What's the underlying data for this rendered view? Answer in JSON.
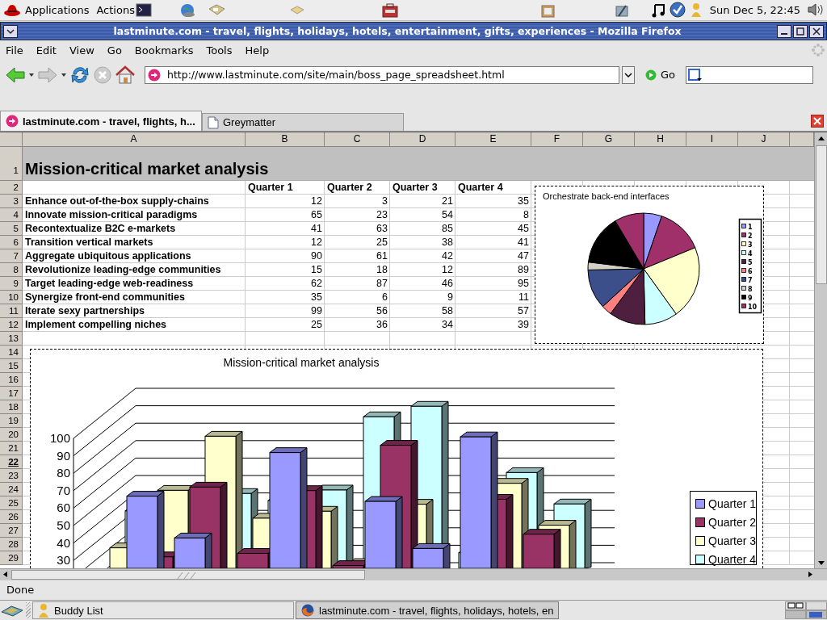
{
  "top_panel": {
    "menus": [
      "Applications",
      "Actions"
    ],
    "clock": "Sun Dec  5, 22:45"
  },
  "window": {
    "title": "lastminute.com - travel, flights, holidays, hotels, entertainment, gifts, experiences - Mozilla Firefox"
  },
  "menu_bar": [
    "File",
    "Edit",
    "View",
    "Go",
    "Bookmarks",
    "Tools",
    "Help"
  ],
  "nav": {
    "url": "http://www.lastminute.com/site/main/boss_page_spreadsheet.html",
    "go": "Go"
  },
  "tabs": [
    {
      "label": "lastminute.com - travel, flights, h...",
      "selected": true
    },
    {
      "label": "Greymatter",
      "selected": false
    }
  ],
  "sheet": {
    "columns": [
      "A",
      "B",
      "C",
      "D",
      "E",
      "F",
      "G",
      "H",
      "I",
      "J"
    ],
    "row_headers": [
      {
        "label": "1",
        "selected": false
      },
      {
        "label": "2",
        "selected": false
      },
      {
        "label": "3",
        "selected": false
      },
      {
        "label": "4",
        "selected": false
      },
      {
        "label": "5",
        "selected": false
      },
      {
        "label": "6",
        "selected": false
      },
      {
        "label": "7",
        "selected": false
      },
      {
        "label": "8",
        "selected": false
      },
      {
        "label": "9",
        "selected": false
      },
      {
        "label": "10",
        "selected": false
      },
      {
        "label": "11",
        "selected": false
      },
      {
        "label": "12",
        "selected": false
      },
      {
        "label": "13",
        "selected": false
      },
      {
        "label": "14",
        "selected": false
      },
      {
        "label": "15",
        "selected": false
      },
      {
        "label": "16",
        "selected": false
      },
      {
        "label": "17",
        "selected": false
      },
      {
        "label": "18",
        "selected": false
      },
      {
        "label": "19",
        "selected": false
      },
      {
        "label": "20",
        "selected": false
      },
      {
        "label": "21",
        "selected": false
      },
      {
        "label": "22",
        "selected": true
      },
      {
        "label": "23",
        "selected": false
      },
      {
        "label": "24",
        "selected": false
      },
      {
        "label": "25",
        "selected": false
      },
      {
        "label": "26",
        "selected": false
      },
      {
        "label": "27",
        "selected": false
      },
      {
        "label": "28",
        "selected": false
      },
      {
        "label": "29",
        "selected": false
      }
    ],
    "title": "Mission-critical market analysis",
    "header": [
      "Quarter 1",
      "Quarter 2",
      "Quarter 3",
      "Quarter 4"
    ],
    "rows": [
      {
        "label": "Enhance out-of-the-box supply-chains",
        "values": [
          "12",
          "3",
          "21",
          "35"
        ]
      },
      {
        "label": "Innovate mission-critical paradigms",
        "values": [
          "65",
          "23",
          "54",
          "8"
        ]
      },
      {
        "label": "Recontextualize B2C e-markets",
        "values": [
          "41",
          "63",
          "85",
          "45"
        ]
      },
      {
        "label": "Transition vertical markets",
        "values": [
          "12",
          "25",
          "38",
          "41"
        ]
      },
      {
        "label": "Aggregate ubiquitous applications",
        "values": [
          "90",
          "61",
          "42",
          "47"
        ]
      },
      {
        "label": "Revolutionize leading-edge communities",
        "values": [
          "15",
          "18",
          "12",
          "89"
        ]
      },
      {
        "label": "Target leading-edge web-readiness",
        "values": [
          "62",
          "87",
          "46",
          "95"
        ]
      },
      {
        "label": "Synergize front-end communities",
        "values": [
          "35",
          "6",
          "9",
          "11"
        ]
      },
      {
        "label": "Iterate sexy partnerships",
        "values": [
          "99",
          "56",
          "58",
          "57"
        ]
      },
      {
        "label": "Implement compelling niches",
        "values": [
          "25",
          "36",
          "34",
          "39"
        ]
      }
    ],
    "pie_chart": {
      "chart_data": {
        "type": "pie",
        "title": "Orchestrate back-end interfaces",
        "categories": [
          "1",
          "2",
          "3",
          "4",
          "5",
          "6",
          "7",
          "8",
          "9",
          "10"
        ],
        "values": [
          5.26,
          13.53,
          21.3,
          9.52,
          10.53,
          3.01,
          11.53,
          2.26,
          14.54,
          8.52
        ],
        "legend": "right"
      }
    },
    "bar_chart": {
      "title": "Mission-critical market analysis",
      "y_axis_labels": [
        "100",
        "90",
        "80",
        "70",
        "60",
        "50",
        "40",
        "30"
      ],
      "legend": [
        {
          "name": "Quarter 1",
          "color": "#9999ff"
        },
        {
          "name": "Quarter 2",
          "color": "#993366"
        },
        {
          "name": "Quarter 3",
          "color": "#ffffcc"
        },
        {
          "name": "Quarter 4",
          "color": "#ccffff"
        }
      ]
    }
  },
  "status_bar": "Done",
  "taskbar": [
    {
      "label": "Buddy List",
      "selected": false
    },
    {
      "label": "lastminute.com - travel, flights, holidays, hotels, en",
      "selected": true
    }
  ]
}
